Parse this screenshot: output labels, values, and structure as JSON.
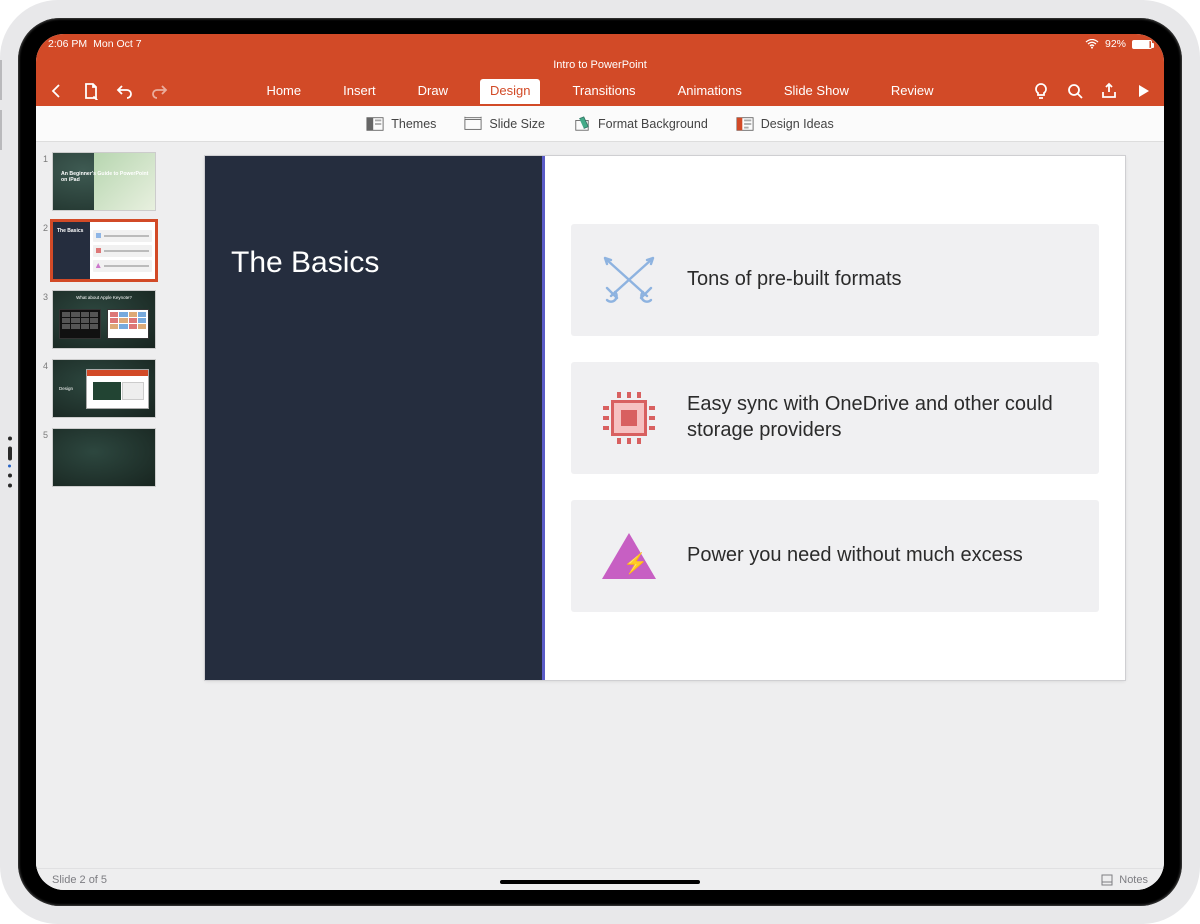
{
  "status": {
    "time": "2:06 PM",
    "date": "Mon Oct 7",
    "battery_pct": "92%"
  },
  "document": {
    "title": "Intro to PowerPoint"
  },
  "ribbon_tabs": {
    "home": "Home",
    "insert": "Insert",
    "draw": "Draw",
    "design": "Design",
    "transitions": "Transitions",
    "animations": "Animations",
    "slideshow": "Slide Show",
    "review": "Review",
    "active": "design"
  },
  "design_tools": {
    "themes": "Themes",
    "slide_size": "Slide Size",
    "format_bg": "Format Background",
    "design_ideas": "Design Ideas"
  },
  "thumbnails": [
    {
      "n": "1",
      "caption": "An Beginner's Guide to PowerPoint on iPad"
    },
    {
      "n": "2",
      "caption": "The Basics"
    },
    {
      "n": "3",
      "caption": "What about Apple Keynote?"
    },
    {
      "n": "4",
      "caption": "Design"
    },
    {
      "n": "5",
      "caption": ""
    }
  ],
  "selected_slide_index": 1,
  "slide": {
    "title": "The Basics",
    "features": [
      {
        "icon": "swords-icon",
        "text": "Tons of pre-built formats"
      },
      {
        "icon": "chip-icon",
        "text": "Easy sync with OneDrive and other could storage providers"
      },
      {
        "icon": "bolt-triangle-icon",
        "text": "Power you need without much excess"
      }
    ]
  },
  "footer": {
    "counter": "Slide 2 of 5",
    "notes_label": "Notes"
  }
}
